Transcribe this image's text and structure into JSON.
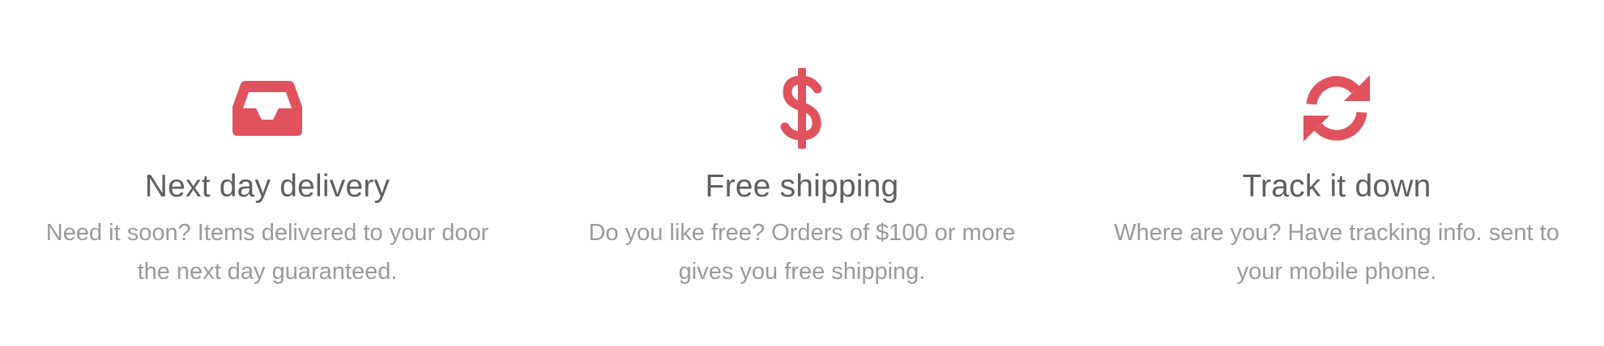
{
  "theme": {
    "accent": "#e0525e"
  },
  "features": [
    {
      "icon": "inbox-icon",
      "title": "Next day delivery",
      "description": "Need it soon? Items delivered to your door the next day guaranteed."
    },
    {
      "icon": "dollar-icon",
      "title": "Free shipping",
      "description": "Do you like free? Orders of $100 or more gives you free shipping."
    },
    {
      "icon": "refresh-icon",
      "title": "Track it down",
      "description": "Where are you? Have tracking info. sent to your mobile phone."
    }
  ]
}
